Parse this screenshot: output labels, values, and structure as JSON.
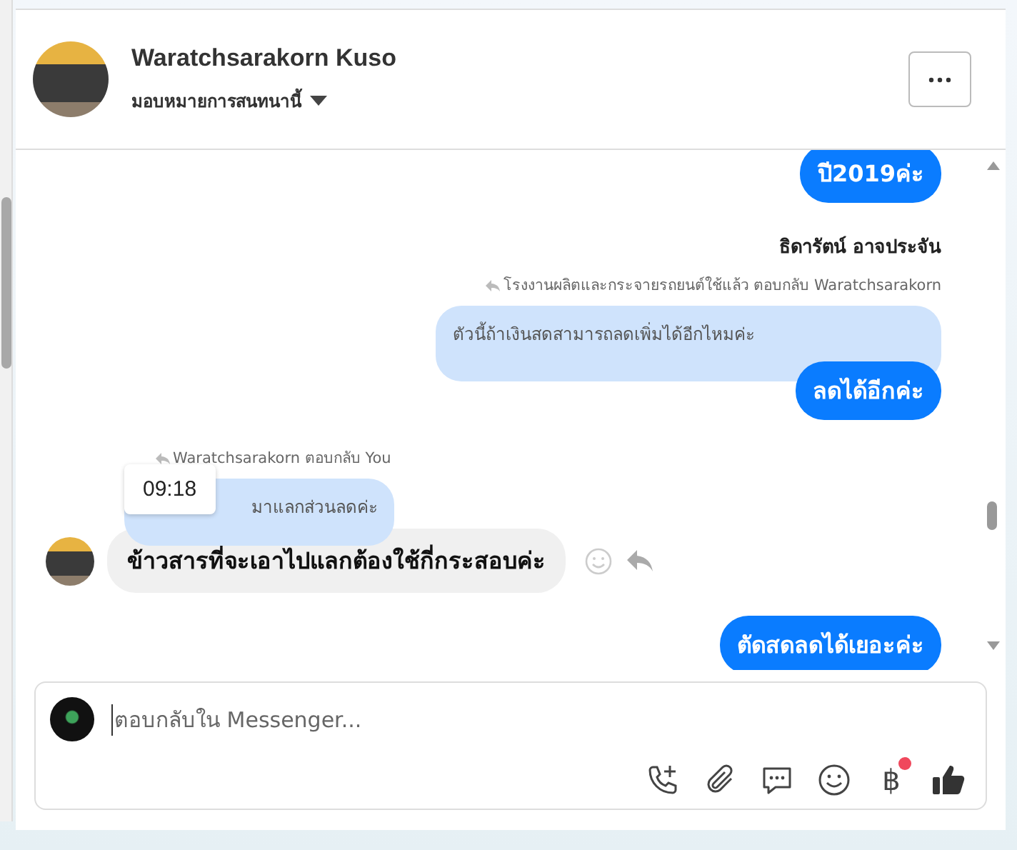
{
  "header": {
    "name": "Waratchsarakorn Kuso",
    "assign_label": "มอบหมายการสนทนานี้"
  },
  "messages": [
    {
      "kind": "sent",
      "text": "ปี2019ค่ะ"
    },
    {
      "kind": "sender_name",
      "text": "ธิดารัตน์ อาจประจัน"
    },
    {
      "kind": "reply_header_out",
      "text": "โรงงานผลิตและกระจายรถยนต์ใช้แล้ว ตอบกลับ Waratchsarakorn"
    },
    {
      "kind": "quoted_out",
      "text": "ตัวนี้ถ้าเงินสดสามารถลดเพิ่มได้อีกไหมค่ะ"
    },
    {
      "kind": "sent",
      "text": "ลดได้อีกค่ะ"
    },
    {
      "kind": "reply_header_in",
      "text": "Waratchsarakorn ตอบกลับ You"
    },
    {
      "kind": "quoted_in",
      "text": "มาแลกส่วนลดค่ะ",
      "tooltip": "09:18"
    },
    {
      "kind": "received",
      "text": "ข้าวสารที่จะเอาไปแลกต้องใช้กี่กระสอบค่ะ"
    },
    {
      "kind": "sent",
      "text": "ตัดสดลดได้เยอะค่ะ"
    }
  ],
  "composer": {
    "placeholder": "ตอบกลับใน Messenger...",
    "currency_symbol": "฿",
    "currency_notification": true
  }
}
